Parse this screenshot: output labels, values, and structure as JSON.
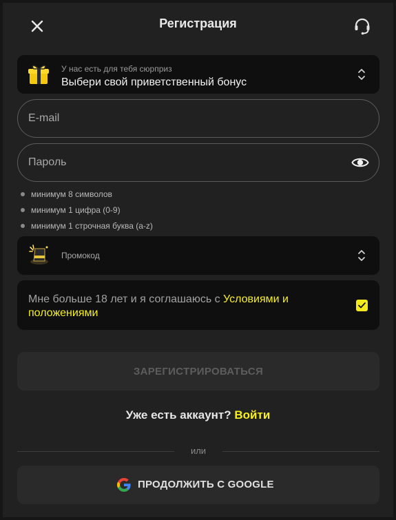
{
  "header": {
    "title": "Регистрация",
    "close_icon": "close-icon",
    "support_icon": "headset-icon"
  },
  "bonus": {
    "caption": "У нас есть для тебя сюрприз",
    "value": "Выбери свой приветственный бонус",
    "icon": "gift-icon"
  },
  "email": {
    "placeholder": "E-mail",
    "value": ""
  },
  "password": {
    "placeholder": "Пароль",
    "value": "",
    "toggle_icon": "eye-icon"
  },
  "password_rules": [
    "минимум 8 символов",
    "минимум 1 цифра (0-9)",
    "минимум 1 строчная буква (a-z)"
  ],
  "promo": {
    "label": "Промокод",
    "icon": "magic-hat-icon"
  },
  "consent": {
    "text": "Мне больше 18 лет и я соглашаюсь с ",
    "link": "Условиями и положениями",
    "checked": true
  },
  "register_button": "ЗАРЕГИСТРИРОВАТЬСЯ",
  "login": {
    "text": "Уже есть аккаунт?",
    "link": "Войти"
  },
  "divider_text": "или",
  "google_button": "ПРОДОЛЖИТЬ С GOOGLE",
  "colors": {
    "accent": "#f7f01e",
    "background": "#212121",
    "panel": "#0f0f0f",
    "button": "#2a2a2a"
  }
}
